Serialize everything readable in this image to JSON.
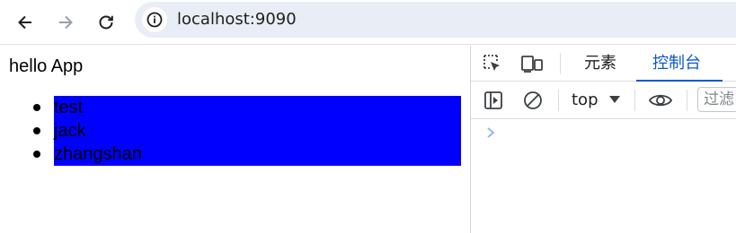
{
  "browser": {
    "url": "localhost:9090",
    "icons": {
      "back": "arrow-left-icon",
      "forward": "arrow-right-icon",
      "reload": "reload-icon",
      "site_info": "site-info-icon"
    }
  },
  "page": {
    "heading": "hello App",
    "list_items": [
      "test",
      "jack",
      "zhangshan"
    ],
    "list_background": "#0000ff"
  },
  "devtools": {
    "tabs": [
      {
        "label": "元素",
        "active": false
      },
      {
        "label": "控制台",
        "active": true
      }
    ],
    "context": "top",
    "filter_placeholder": "过滤",
    "accent": "#0b57d0"
  }
}
